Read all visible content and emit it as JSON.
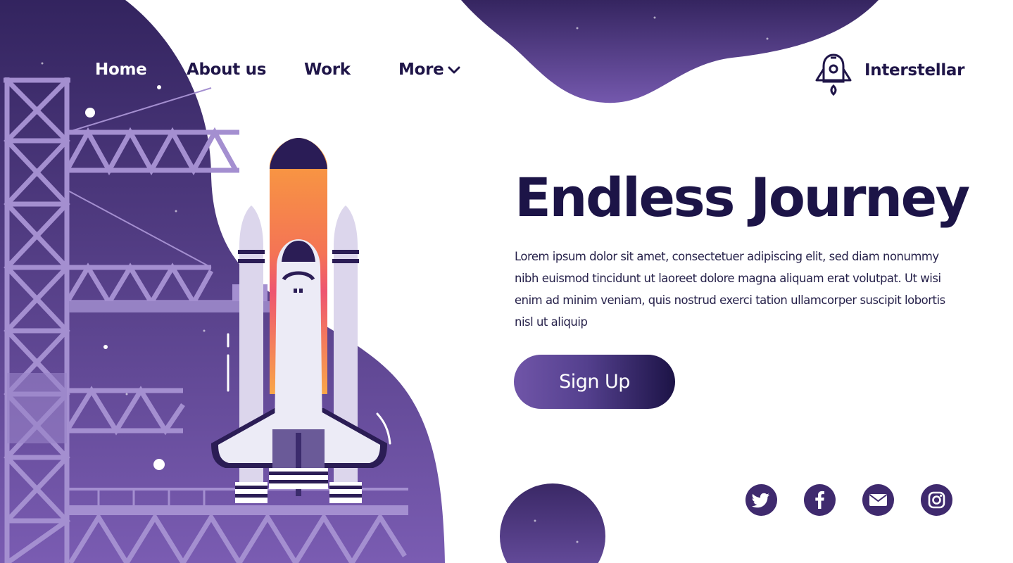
{
  "nav": {
    "items": [
      {
        "label": "Home"
      },
      {
        "label": "About us"
      },
      {
        "label": "Work"
      },
      {
        "label": "More"
      }
    ]
  },
  "brand": {
    "name": "Interstellar",
    "icon": "rocket-capsule-icon"
  },
  "hero": {
    "title": "Endless Journey",
    "body": "Lorem ipsum dolor sit amet, consectetuer adipiscing elit, sed diam nonummy nibh euismod tincidunt ut laoreet dolore magna aliquam erat volutpat. Ut wisi enim ad minim veniam, quis nostrud exerci tation ullamcorper suscipit lobortis nisl ut aliquip",
    "cta_label": "Sign Up"
  },
  "social": [
    {
      "icon": "twitter-icon"
    },
    {
      "icon": "facebook-icon"
    },
    {
      "icon": "mail-icon"
    },
    {
      "icon": "instagram-icon"
    }
  ],
  "colors": {
    "ink": "#1c1447",
    "purple_dark": "#3f2a6e",
    "purple_mid": "#6a4fa3",
    "lavender": "#a08bcc",
    "booster_orange": "#f7a23f",
    "booster_red": "#ec5370",
    "white": "#ffffff"
  }
}
